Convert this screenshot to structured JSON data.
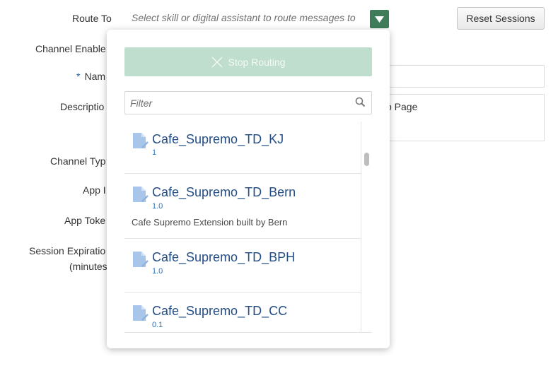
{
  "form": {
    "route_to_label": "Route To",
    "route_to_placeholder": "Select skill or digital assistant to route messages to",
    "reset_sessions_label": "Reset Sessions",
    "channel_enabled_label": "Channel Enable",
    "name_required": "*",
    "name_label": "Nam",
    "description_label": "Descriptio",
    "description_visible_text": "b Page",
    "channel_type_label": "Channel Typ",
    "app_id_label": "App I",
    "app_token_label": "App Toke",
    "session_expiration_label": "Session Expiratio",
    "session_expiration_unit": "(minutes"
  },
  "dropdown": {
    "stop_routing_label": "Stop Routing",
    "filter_placeholder": "Filter",
    "items": [
      {
        "name": "Cafe_Supremo_TD_KJ",
        "version": "1",
        "description": ""
      },
      {
        "name": "Cafe_Supremo_TD_Bern",
        "version": "1.0",
        "description": "Cafe Supremo Extension built by Bern"
      },
      {
        "name": "Cafe_Supremo_TD_BPH",
        "version": "1.0",
        "description": ""
      },
      {
        "name": "Cafe_Supremo_TD_CC",
        "version": "0.1",
        "description": ""
      }
    ]
  },
  "colors": {
    "accent_green": "#3f7d5a",
    "stop_routing_bg": "#c0dece",
    "item_name": "#234d83",
    "item_version": "#2a73c0"
  },
  "icons": {
    "dropdown_toggle": "chevron-down-icon",
    "stop_routing": "close-icon",
    "filter": "search-icon",
    "item": "skill-document-icon"
  }
}
